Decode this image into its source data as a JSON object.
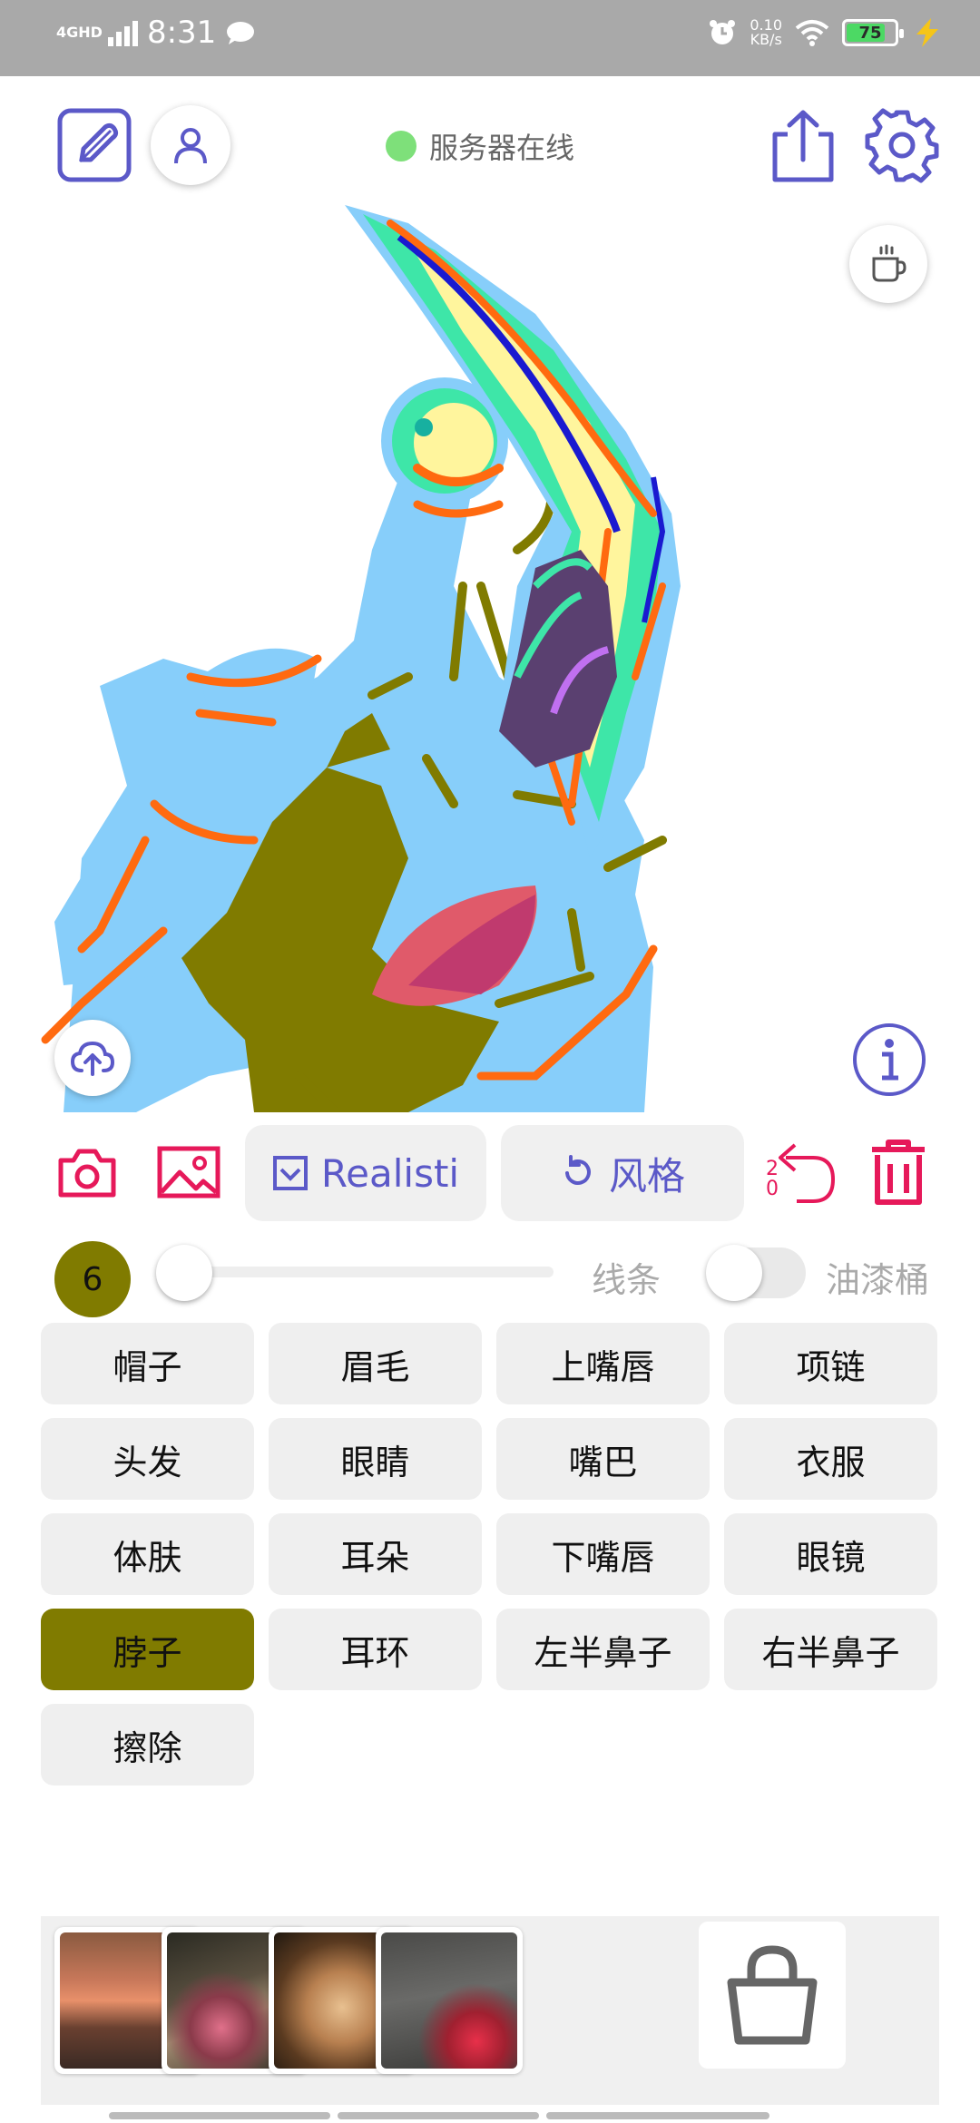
{
  "status_bar": {
    "network": "4GHD",
    "time": "8:31",
    "speed_value": "0.10",
    "speed_unit": "KB/s",
    "battery": "75"
  },
  "header": {
    "server_status": "服务器在线",
    "server_status_color": "#7ee07a"
  },
  "toolbar": {
    "model_label": "Realisti",
    "style_label": "风格",
    "undo_count": "20"
  },
  "brush": {
    "size": "6",
    "line_label": "线条",
    "bucket_label": "油漆桶"
  },
  "parts": [
    {
      "label": "帽子"
    },
    {
      "label": "眉毛"
    },
    {
      "label": "上嘴唇"
    },
    {
      "label": "项链"
    },
    {
      "label": "头发"
    },
    {
      "label": "眼睛"
    },
    {
      "label": "嘴巴"
    },
    {
      "label": "衣服"
    },
    {
      "label": "体肤"
    },
    {
      "label": "耳朵"
    },
    {
      "label": "下嘴唇"
    },
    {
      "label": "眼镜"
    },
    {
      "label": "脖子"
    },
    {
      "label": "耳环"
    },
    {
      "label": "左半鼻子"
    },
    {
      "label": "右半鼻子"
    },
    {
      "label": "擦除"
    }
  ],
  "active_part": "脖子",
  "colors": {
    "accent": "#5b59c8",
    "danger": "#e6195a",
    "neck": "#807b00",
    "skin": "#87cefa"
  }
}
